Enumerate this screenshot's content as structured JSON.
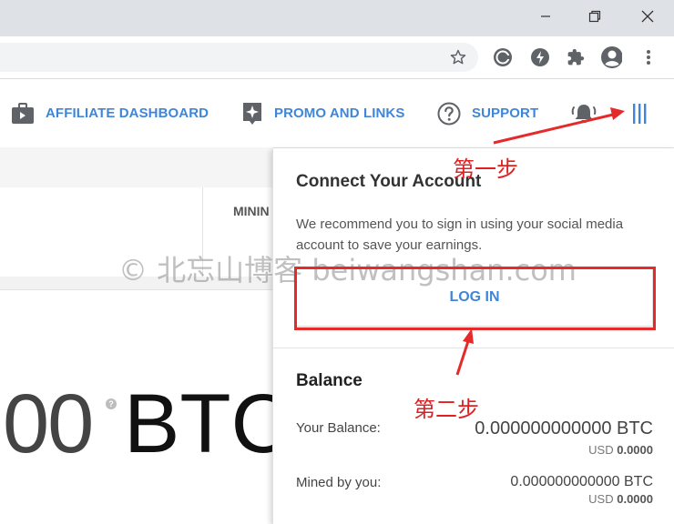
{
  "browser": {
    "window_controls": [
      "minimize-icon",
      "restore-icon",
      "close-icon"
    ],
    "toolbar_icons": [
      "star-icon",
      "extension-c-icon",
      "extension-bolt-icon",
      "puzzle-icon",
      "profile-icon",
      "menu-dots-icon"
    ]
  },
  "nav": {
    "affiliate": "AFFILIATE DASHBOARD",
    "promo": "PROMO AND LINKS",
    "support": "SUPPORT",
    "bell_icon": "bell-icon",
    "menu_icon": "menu-bars-icon"
  },
  "page": {
    "mining_label": "MININ",
    "big_amount": "00",
    "big_unit": "BTC",
    "help_mark": "?"
  },
  "panel": {
    "title": "Connect Your Account",
    "description": "We recommend you to sign in using your social media account to save your earnings.",
    "login_label": "LOG IN",
    "balance_title": "Balance",
    "your_balance_label": "Your Balance:",
    "your_balance_value": "0.000000000000 BTC",
    "your_balance_usd_prefix": "USD",
    "your_balance_usd": "0.0000",
    "mined_label": "Mined by you:",
    "mined_value": "0.000000000000 BTC",
    "mined_usd_prefix": "USD",
    "mined_usd": "0.0000"
  },
  "annotations": {
    "step1": "第一步",
    "step2": "第二步",
    "watermark": "© 北忘山博客 beiwangshan.com",
    "accent": "#e52a2a"
  },
  "colors": {
    "brand_blue": "#3f86d9"
  }
}
